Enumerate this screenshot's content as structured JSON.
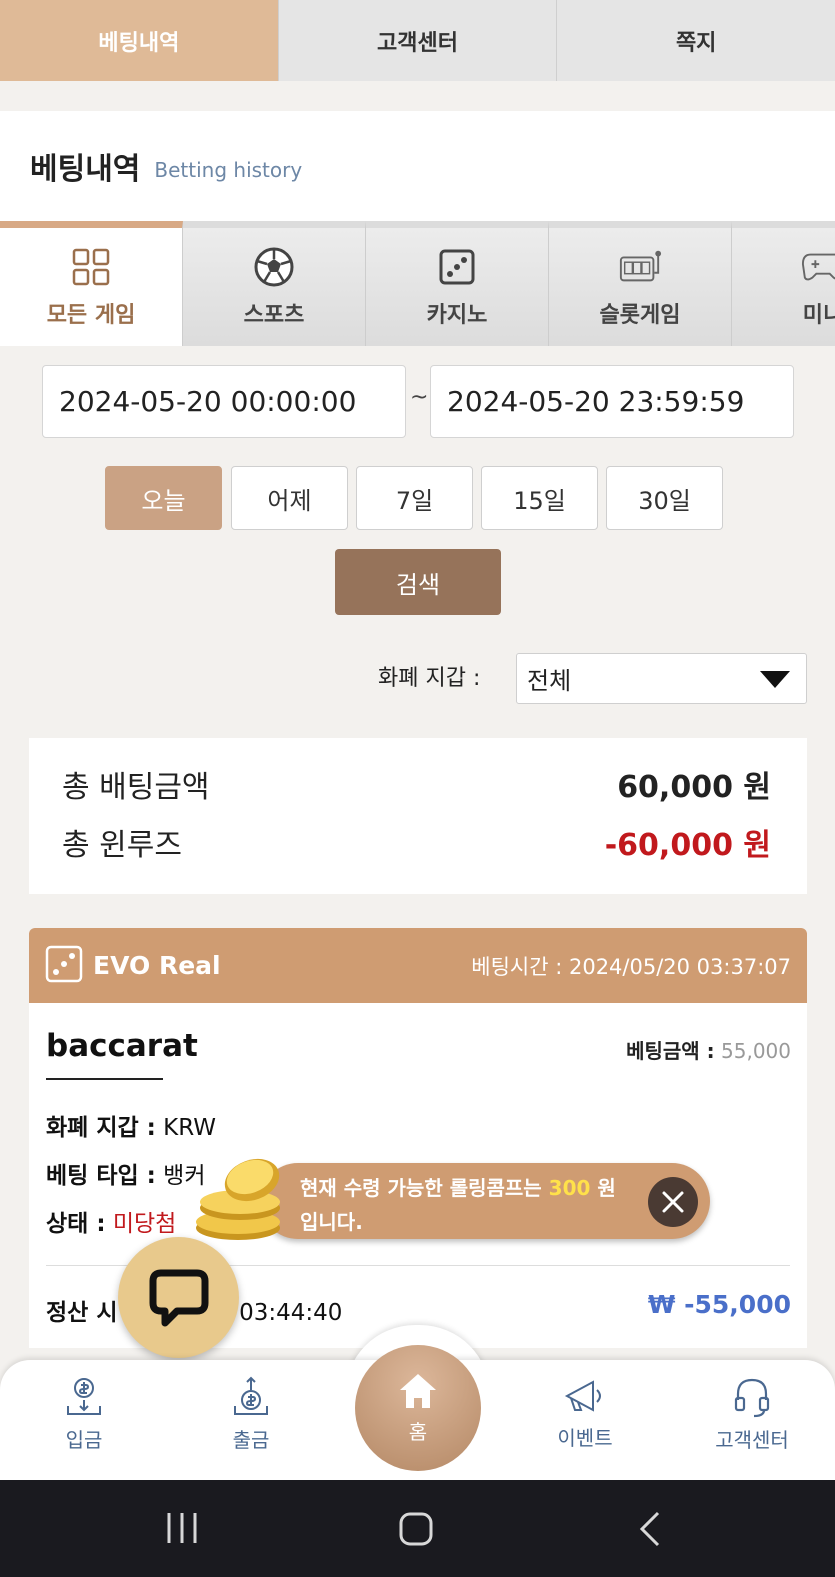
{
  "top_tabs": [
    {
      "label": "베팅내역",
      "active": true
    },
    {
      "label": "고객센터",
      "active": false
    },
    {
      "label": "쪽지",
      "active": false
    }
  ],
  "header": {
    "title": "베팅내역",
    "subtitle": "Betting history"
  },
  "game_tabs": [
    {
      "label": "모든 게임",
      "icon": "grid-icon",
      "active": true
    },
    {
      "label": "스포츠",
      "icon": "soccer-ball-icon",
      "active": false
    },
    {
      "label": "카지노",
      "icon": "dice-icon",
      "active": false
    },
    {
      "label": "슬롯게임",
      "icon": "slot-machine-icon",
      "active": false
    },
    {
      "label": "미니",
      "icon": "gamepad-icon",
      "active": false
    }
  ],
  "date_range": {
    "start": "2024-05-20 00:00:00",
    "separator": "~",
    "end": "2024-05-20 23:59:59"
  },
  "quick_ranges": [
    {
      "label": "오늘",
      "active": true
    },
    {
      "label": "어제",
      "active": false
    },
    {
      "label": "7일",
      "active": false
    },
    {
      "label": "15일",
      "active": false
    },
    {
      "label": "30일",
      "active": false
    }
  ],
  "search_label": "검색",
  "wallet_filter": {
    "label": "화폐 지갑 :",
    "value": "전체"
  },
  "summary": {
    "total_bet_label": "총 배팅금액",
    "total_bet_value": "60,000 원",
    "total_winloss_label": "총 윈루즈",
    "total_winloss_value": "-60,000 원"
  },
  "bet_card": {
    "provider": "EVO Real",
    "bet_time_label": "베팅시간 :",
    "bet_time": "2024/05/20 03:37:07",
    "game": "baccarat",
    "bet_amount_label": "베팅금액 :",
    "bet_amount": "55,000",
    "wallet_label": "화폐 지갑 :",
    "wallet_value": "KRW",
    "bet_type_label": "베팅 타입 :",
    "bet_type_value": "뱅커",
    "status_label": "상태 :",
    "status_value": "미당첨",
    "settle_label": "정산 시",
    "settle_time": "05/20 03:44:40",
    "settle_amount": "₩ -55,000"
  },
  "toast": {
    "text_before": "현재 수령 가능한 롤링콤프는 ",
    "highlight": "300",
    "text_after": " 원",
    "line2": "입니다."
  },
  "bottom_nav": [
    {
      "label": "입금",
      "icon": "deposit-icon"
    },
    {
      "label": "출금",
      "icon": "withdraw-icon"
    },
    {
      "label": "홈",
      "icon": "home-icon"
    },
    {
      "label": "이벤트",
      "icon": "megaphone-icon"
    },
    {
      "label": "고객센터",
      "icon": "headset-icon"
    }
  ],
  "colors": {
    "accent": "#cf9c72",
    "tab_active": "#dfba97",
    "search_btn": "#96735a",
    "negative": "#c1191d",
    "settle_blue": "#4a6fc9"
  }
}
